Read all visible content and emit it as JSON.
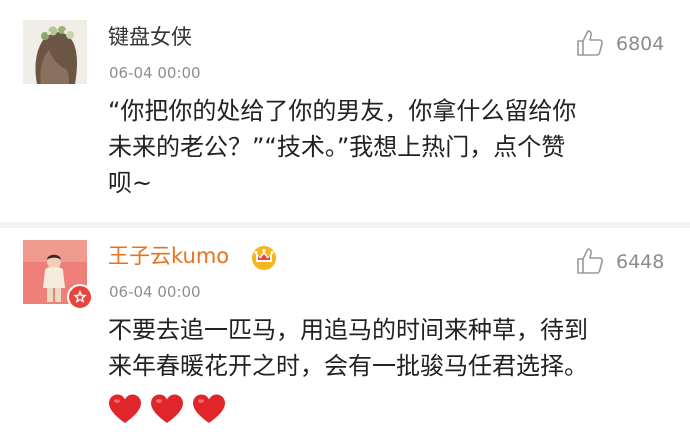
{
  "comments": [
    {
      "username": "键盘女侠",
      "timestamp": "06-04 00:00",
      "like_count": "6804",
      "body_lines": [
        "“你把你的处给了你的男友，你拿什么留给你",
        "未来的老公？”“技术。”我想上热门，点个赞",
        "呗~"
      ]
    },
    {
      "username": "王子云kumo",
      "timestamp": "06-04 00:00",
      "like_count": "6448",
      "verified_badge": "vip-star-icon",
      "member_icon": "crown-icon",
      "body_lines": [
        "不要去追一匹马，用追马的时间来种草，待到",
        "来年春暖花开之时，会有一批骏马任君选择。"
      ],
      "emoji": [
        "heart-icon",
        "heart-icon",
        "heart-icon"
      ]
    }
  ],
  "colors": {
    "username_default": "#333333",
    "username_member": "#e8711c",
    "meta_grey": "#8e8e8e",
    "separator": "#f2f2f2",
    "heart_red": "#e0262a",
    "badge_red": "#e8453c",
    "crown_gold": "#f5b51d"
  }
}
